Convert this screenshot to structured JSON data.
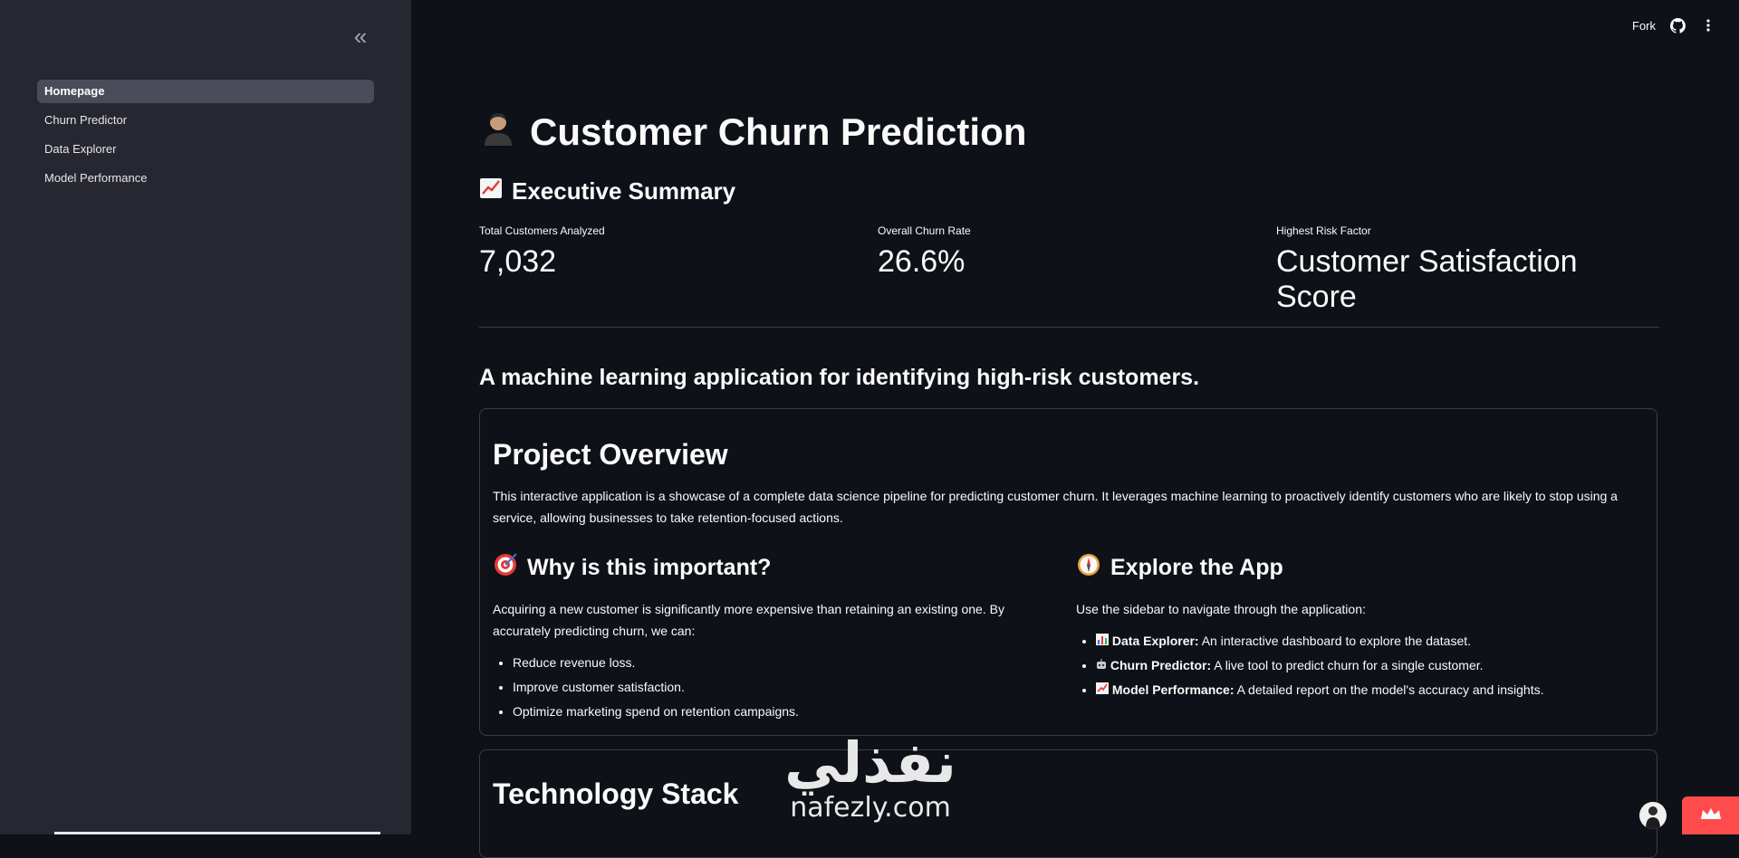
{
  "sidebar": {
    "collapse_icon": "double-chevron-left-icon",
    "items": [
      {
        "label": "Homepage",
        "active": true
      },
      {
        "label": "Churn Predictor",
        "active": false
      },
      {
        "label": "Data Explorer",
        "active": false
      },
      {
        "label": "Model Performance",
        "active": false
      }
    ]
  },
  "header": {
    "fork_label": "Fork",
    "icons": [
      "github-icon",
      "more-vertical-icon"
    ]
  },
  "main": {
    "title": "Customer Churn Prediction",
    "title_icon": "person-emoji-icon",
    "executive_summary": {
      "heading": "Executive Summary",
      "icon": "chart-increasing-icon",
      "metrics": [
        {
          "label": "Total Customers Analyzed",
          "value": "7,032"
        },
        {
          "label": "Overall Churn Rate",
          "value": "26.6%"
        },
        {
          "label": "Highest Risk Factor",
          "value": "Customer Satisfaction Score"
        }
      ]
    },
    "tagline": "A machine learning application for identifying high-risk customers.",
    "overview": {
      "title": "Project Overview",
      "description": "This interactive application is a showcase of a complete data science pipeline for predicting customer churn. It leverages machine learning to proactively identify customers who are likely to stop using a service, allowing businesses to take retention-focused actions.",
      "why": {
        "heading": "Why is this important?",
        "icon": "target-icon",
        "text": "Acquiring a new customer is significantly more expensive than retaining an existing one. By accurately predicting churn, we can:",
        "bullets": [
          "Reduce revenue loss.",
          "Improve customer satisfaction.",
          "Optimize marketing spend on retention campaigns."
        ]
      },
      "explore": {
        "heading": "Explore the App",
        "icon": "compass-icon",
        "text": "Use the sidebar to navigate through the application:",
        "items": [
          {
            "icon": "bar-chart-icon",
            "name": "Data Explorer:",
            "desc": " An interactive dashboard to explore the dataset."
          },
          {
            "icon": "robot-icon",
            "name": "Churn Predictor:",
            "desc": " A live tool to predict churn for a single customer."
          },
          {
            "icon": "chart-increasing-icon",
            "name": "Model Performance:",
            "desc": " A detailed report on the model's accuracy and insights."
          }
        ]
      }
    },
    "tech": {
      "title": "Technology Stack"
    }
  },
  "watermark": {
    "arabic": "نفذلي",
    "latin": "nafezly.com"
  },
  "colors": {
    "background": "#0e1117",
    "sidebar": "#262730",
    "active_nav": "#4a4c59",
    "accent": "#ff4b4b"
  }
}
